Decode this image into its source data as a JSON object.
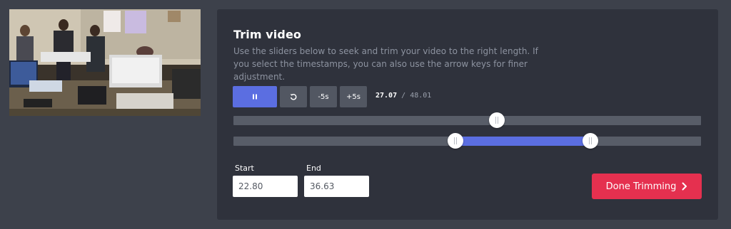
{
  "trim": {
    "title": "Trim video",
    "description": "Use the sliders below to seek and trim your video to the right length. If you select the timestamps, you can also use the arrow keys for finer adjustment."
  },
  "controls": {
    "play_pause_icon": "pause-icon",
    "restart_icon": "restart-icon",
    "back_label": "-5s",
    "forward_label": "+5s"
  },
  "time": {
    "current": "27.07",
    "separator": "/",
    "duration": "48.01"
  },
  "seek": {
    "position_seconds": 27.07,
    "duration_seconds": 48.01
  },
  "trim_range": {
    "start_seconds": 22.8,
    "end_seconds": 36.63
  },
  "inputs": {
    "start_label": "Start",
    "start_value": "22.80",
    "end_label": "End",
    "end_value": "36.63"
  },
  "done": {
    "label": "Done Trimming",
    "icon": "chevron-right-icon"
  },
  "colors": {
    "accent": "#5b6ee1",
    "done": "#e5304f",
    "panel": "#2f323c",
    "background": "#3d414b"
  }
}
